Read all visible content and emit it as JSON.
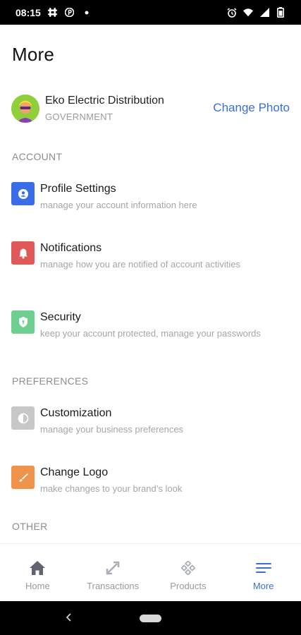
{
  "status_bar": {
    "time": "08:15",
    "left_icons": [
      "slack-icon",
      "pinterest-icon",
      "dot-icon"
    ],
    "right_icons": [
      "alarm-icon",
      "wifi-icon",
      "signal-icon",
      "battery-icon"
    ]
  },
  "page": {
    "title": "More"
  },
  "profile": {
    "name": "Eko Electric Distribution",
    "type": "GOVERNMENT",
    "change_photo_label": "Change Photo"
  },
  "sections": {
    "account": "ACCOUNT",
    "preferences": "PREFERENCES",
    "other": "OTHER"
  },
  "menu": {
    "profile_settings": {
      "title": "Profile Settings",
      "subtitle": "manage your account information here",
      "icon": "user-icon",
      "color": "#3a6ee8"
    },
    "notifications": {
      "title": "Notifications",
      "subtitle": "manage how you are notified of account activities",
      "icon": "bell-icon",
      "color": "#e05858"
    },
    "security": {
      "title": "Security",
      "subtitle": "keep your account protected, manage your passwords",
      "icon": "shield-icon",
      "color": "#6fcf8e"
    },
    "customization": {
      "title": "Customization",
      "subtitle": "manage your business preferences",
      "icon": "contrast-icon",
      "color": "#c7c7c7"
    },
    "change_logo": {
      "title": "Change Logo",
      "subtitle": "make changes to your brand’s look",
      "icon": "brush-icon",
      "color": "#f0934a"
    }
  },
  "bottom_nav": {
    "items": [
      {
        "label": "Home",
        "icon": "home-icon"
      },
      {
        "label": "Transactions",
        "icon": "transfer-icon"
      },
      {
        "label": "Products",
        "icon": "grid-diamond-icon"
      },
      {
        "label": "More",
        "icon": "menu-lines-icon",
        "active": true
      }
    ],
    "active_color": "#3b6fd4",
    "inactive_color": "#9a9a9a"
  }
}
